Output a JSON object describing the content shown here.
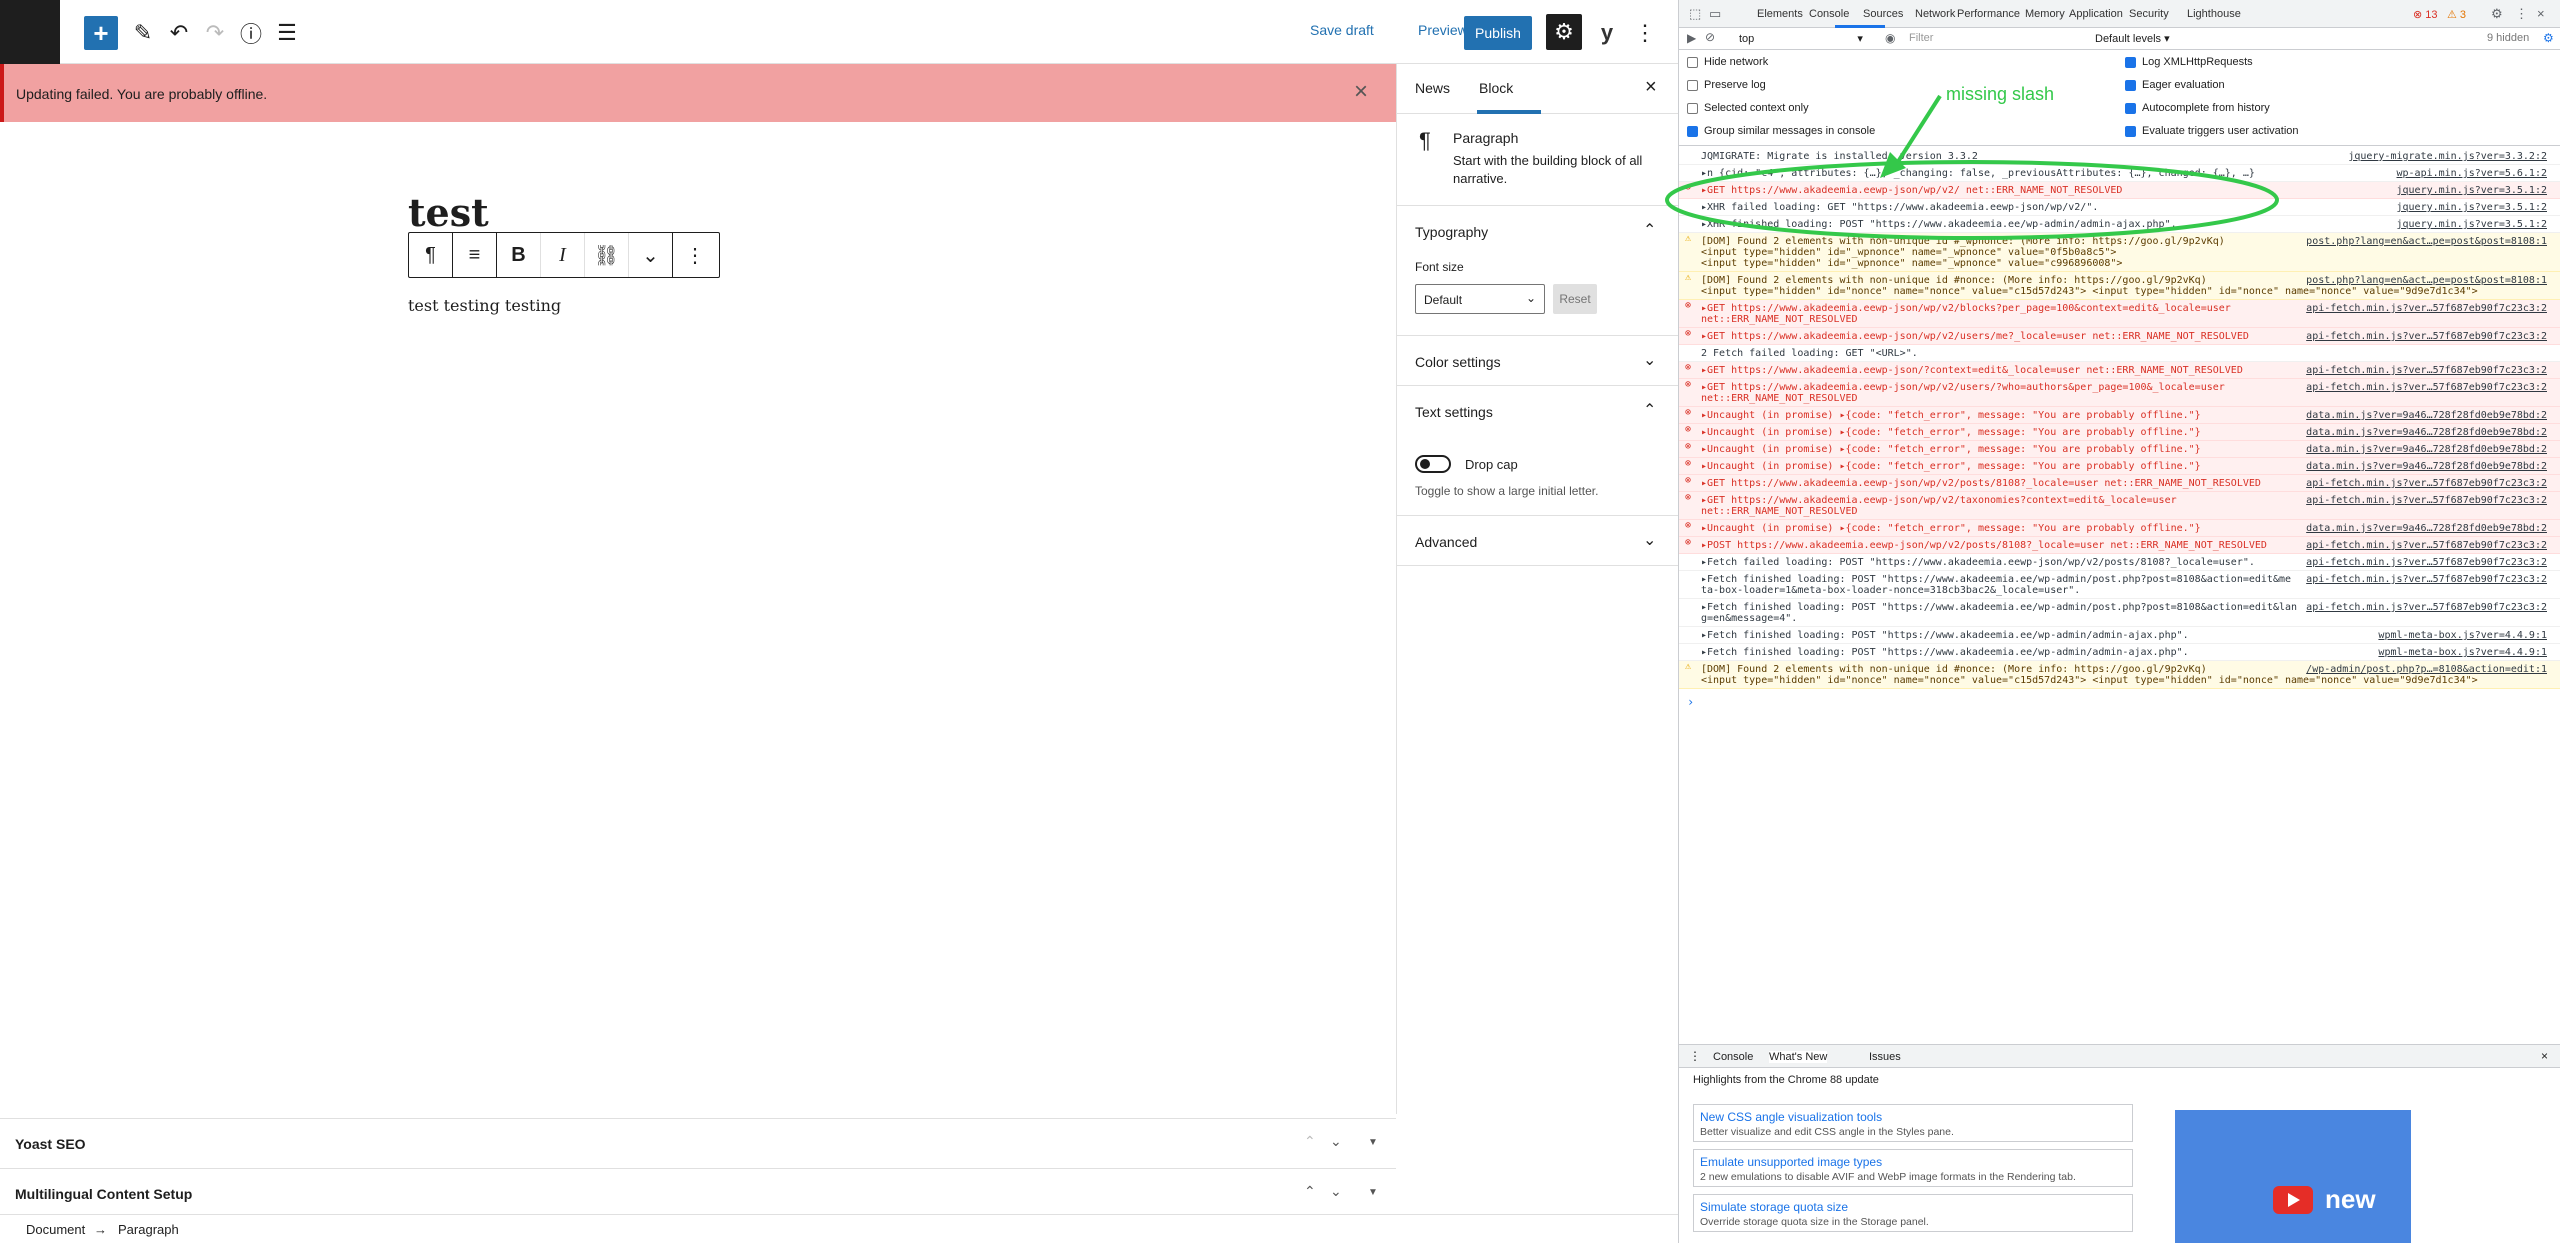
{
  "notice": {
    "text": "Updating failed. You are probably offline."
  },
  "topbar": {
    "save_draft": "Save draft",
    "preview": "Preview",
    "publish": "Publish"
  },
  "post": {
    "title": "test",
    "paragraph": "test testing testing"
  },
  "sidebar": {
    "tab_post": "News",
    "tab_block": "Block",
    "block_name": "Paragraph",
    "block_desc": "Start with the building block of all narrative.",
    "typography": "Typography",
    "font_size_label": "Font size",
    "font_size_value": "Default",
    "reset": "Reset",
    "color_settings": "Color settings",
    "text_settings": "Text settings",
    "drop_cap": "Drop cap",
    "drop_cap_help": "Toggle to show a large initial letter.",
    "advanced": "Advanced"
  },
  "metaboxes": {
    "yoast": "Yoast SEO",
    "multilingual": "Multilingual Content Setup"
  },
  "breadcrumb": {
    "doc": "Document",
    "arrow": "→",
    "block": "Paragraph"
  },
  "devtools": {
    "tabs": [
      "Elements",
      "Console",
      "Sources",
      "Network",
      "Performance",
      "Memory",
      "Application",
      "Security",
      "Lighthouse"
    ],
    "errors": "13",
    "warnings": "3",
    "context": "top",
    "filter_placeholder": "Filter",
    "levels": "Default levels",
    "hidden_issues": "9 hidden",
    "settings_left": [
      "Hide network",
      "Preserve log",
      "Selected context only",
      "Group similar messages in console"
    ],
    "settings_left_on": [
      false,
      false,
      false,
      true
    ],
    "settings_right": [
      "Log XMLHttpRequests",
      "Eager evaluation",
      "Autocomplete from history",
      "Evaluate triggers user activation"
    ],
    "settings_right_on": [
      true,
      true,
      true,
      true
    ],
    "log": [
      {
        "level": "info",
        "msg": "JQMIGRATE: Migrate is installed, version 3.3.2",
        "src": "jquery-migrate.min.js?ver=3.3.2:2"
      },
      {
        "level": "info",
        "msg": "▸n {cid: \"c4\", attributes: {…}, _changing: false, _previousAttributes: {…}, changed: {…}, …}",
        "src": "wp-api.min.js?ver=5.6.1:2"
      },
      {
        "level": "err",
        "msg": "▸GET https://www.akadeemia.eewp-json/wp/v2/ net::ERR_NAME_NOT_RESOLVED",
        "src": "jquery.min.js?ver=3.5.1:2"
      },
      {
        "level": "info",
        "msg": "▸XHR failed loading: GET \"https://www.akadeemia.eewp-json/wp/v2/\".",
        "src": "jquery.min.js?ver=3.5.1:2"
      },
      {
        "level": "info",
        "msg": "▸XHR finished loading: POST \"https://www.akadeemia.ee/wp-admin/admin-ajax.php\".",
        "src": "jquery.min.js?ver=3.5.1:2"
      },
      {
        "level": "warn",
        "msg": "[DOM] Found 2 elements with non-unique id #_wpnonce: (More info: https://goo.gl/9p2vKq)",
        "msg2": "  <input type=\"hidden\" id=\"_wpnonce\" name=\"_wpnonce\" value=\"0f5b0a8c5\">",
        "msg3": "  <input type=\"hidden\" id=\"_wpnonce\" name=\"_wpnonce\" value=\"c996896008\">",
        "src": "post.php?lang=en&act…pe=post&post=8108:1"
      },
      {
        "level": "warn",
        "msg": "[DOM] Found 2 elements with non-unique id #nonce: (More info: https://goo.gl/9p2vKq)",
        "msg2": "  <input type=\"hidden\" id=\"nonce\" name=\"nonce\" value=\"c15d57d243\">   <input type=\"hidden\" id=\"nonce\" name=\"nonce\" value=\"9d9e7d1c34\">",
        "src": "post.php?lang=en&act…pe=post&post=8108:1"
      },
      {
        "level": "err",
        "msg": "▸GET https://www.akadeemia.eewp-json/wp/v2/blocks?per_page=100&context=edit&_locale=user",
        "msg2": "net::ERR_NAME_NOT_RESOLVED",
        "src": "api-fetch.min.js?ver…57f687eb90f7c23c3:2"
      },
      {
        "level": "err",
        "msg": "▸GET https://www.akadeemia.eewp-json/wp/v2/users/me?_locale=user net::ERR_NAME_NOT_RESOLVED",
        "src": "api-fetch.min.js?ver…57f687eb90f7c23c3:2"
      },
      {
        "level": "info",
        "msg": "2  Fetch failed loading: GET \"<URL>\".",
        "src": ""
      },
      {
        "level": "err",
        "msg": "▸GET https://www.akadeemia.eewp-json/?context=edit&_locale=user net::ERR_NAME_NOT_RESOLVED",
        "src": "api-fetch.min.js?ver…57f687eb90f7c23c3:2"
      },
      {
        "level": "err",
        "msg": "▸GET https://www.akadeemia.eewp-json/wp/v2/users/?who=authors&per_page=100&_locale=user",
        "msg2": "net::ERR_NAME_NOT_RESOLVED",
        "src": "api-fetch.min.js?ver…57f687eb90f7c23c3:2"
      },
      {
        "level": "err",
        "msg": "▸Uncaught (in promise) ▸{code: \"fetch_error\", message: \"You are probably offline.\"}",
        "src": "data.min.js?ver=9a46…728f28fd0eb9e78bd:2"
      },
      {
        "level": "err",
        "msg": "▸Uncaught (in promise) ▸{code: \"fetch_error\", message: \"You are probably offline.\"}",
        "src": "data.min.js?ver=9a46…728f28fd0eb9e78bd:2"
      },
      {
        "level": "err",
        "msg": "▸Uncaught (in promise) ▸{code: \"fetch_error\", message: \"You are probably offline.\"}",
        "src": "data.min.js?ver=9a46…728f28fd0eb9e78bd:2"
      },
      {
        "level": "err",
        "msg": "▸Uncaught (in promise) ▸{code: \"fetch_error\", message: \"You are probably offline.\"}",
        "src": "data.min.js?ver=9a46…728f28fd0eb9e78bd:2"
      },
      {
        "level": "err",
        "msg": "▸GET https://www.akadeemia.eewp-json/wp/v2/posts/8108?_locale=user net::ERR_NAME_NOT_RESOLVED",
        "src": "api-fetch.min.js?ver…57f687eb90f7c23c3:2"
      },
      {
        "level": "err",
        "msg": "▸GET https://www.akadeemia.eewp-json/wp/v2/taxonomies?context=edit&_locale=user",
        "msg2": "net::ERR_NAME_NOT_RESOLVED",
        "src": "api-fetch.min.js?ver…57f687eb90f7c23c3:2"
      },
      {
        "level": "err",
        "msg": "▸Uncaught (in promise) ▸{code: \"fetch_error\", message: \"You are probably offline.\"}",
        "src": "data.min.js?ver=9a46…728f28fd0eb9e78bd:2"
      },
      {
        "level": "err",
        "msg": "▸POST https://www.akadeemia.eewp-json/wp/v2/posts/8108?_locale=user net::ERR_NAME_NOT_RESOLVED",
        "src": "api-fetch.min.js?ver…57f687eb90f7c23c3:2"
      },
      {
        "level": "info",
        "msg": "▸Fetch failed loading: POST \"https://www.akadeemia.eewp-json/wp/v2/posts/8108?_locale=user\".",
        "src": "api-fetch.min.js?ver…57f687eb90f7c23c3:2"
      },
      {
        "level": "info",
        "msg": "▸Fetch finished loading: POST \"https://www.akadeemia.ee/wp-admin/post.php?post=8108&action=edit&me",
        "msg2": "ta-box-loader=1&meta-box-loader-nonce=318cb3bac2&_locale=user\".",
        "src": "api-fetch.min.js?ver…57f687eb90f7c23c3:2"
      },
      {
        "level": "info",
        "msg": "▸Fetch finished loading: POST \"https://www.akadeemia.ee/wp-admin/post.php?post=8108&action=edit&lan",
        "msg2": "g=en&message=4\".",
        "src": "api-fetch.min.js?ver…57f687eb90f7c23c3:2"
      },
      {
        "level": "info",
        "msg": "▸Fetch finished loading: POST \"https://www.akadeemia.ee/wp-admin/admin-ajax.php\".",
        "src": "wpml-meta-box.js?ver=4.4.9:1"
      },
      {
        "level": "info",
        "msg": "▸Fetch finished loading: POST \"https://www.akadeemia.ee/wp-admin/admin-ajax.php\".",
        "src": "wpml-meta-box.js?ver=4.4.9:1"
      },
      {
        "level": "warn",
        "msg": "[DOM] Found 2 elements with non-unique id #nonce: (More info: https://goo.gl/9p2vKq)",
        "msg2": "  <input type=\"hidden\" id=\"nonce\" name=\"nonce\" value=\"c15d57d243\">   <input type=\"hidden\" id=\"nonce\" name=\"nonce\" value=\"9d9e7d1c34\">",
        "src": "/wp-admin/post.php?p…=8108&action=edit:1"
      }
    ],
    "drawer_tabs": [
      "Console",
      "What's New",
      "Issues"
    ],
    "whatsnew_title": "Highlights from the Chrome 88 update",
    "whatsnew_cards": [
      {
        "title": "New CSS angle visualization tools",
        "desc": "Better visualize and edit CSS angle in the Styles pane."
      },
      {
        "title": "Emulate unsupported image types",
        "desc": "2 new emulations to disable AVIF and WebP image formats in the Rendering tab."
      },
      {
        "title": "Simulate storage quota size",
        "desc": "Override storage quota size in the Storage panel."
      }
    ],
    "video_text": "new"
  },
  "annotation": {
    "text": "missing slash",
    "color": "#34c84a"
  }
}
